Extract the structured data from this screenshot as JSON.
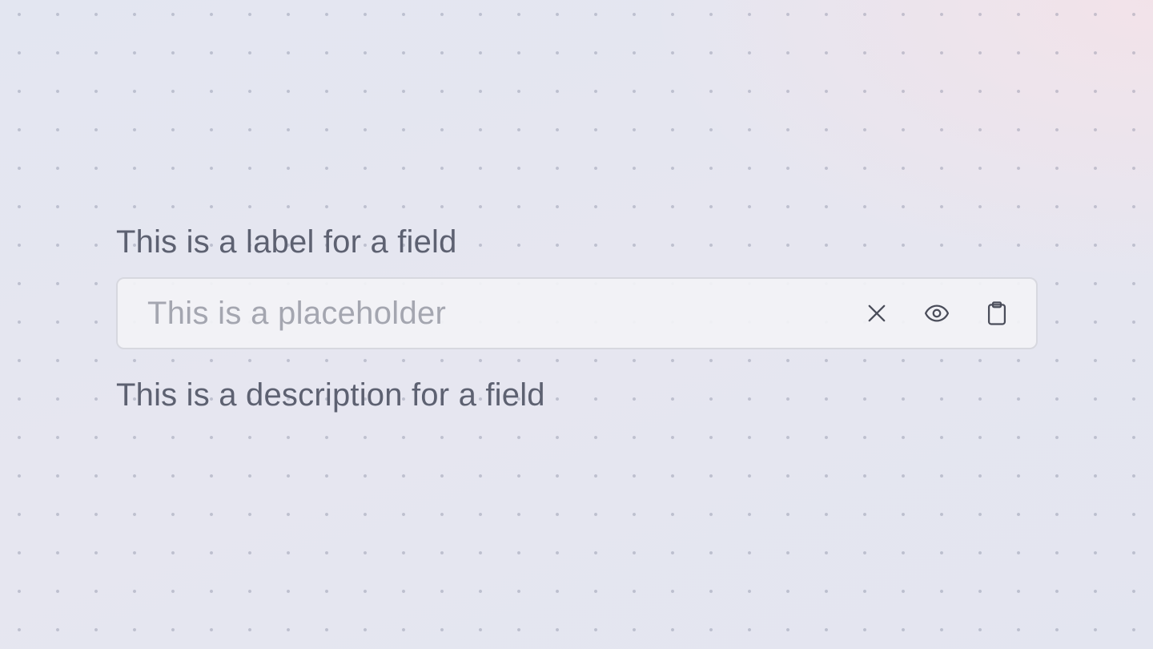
{
  "field": {
    "label": "This is a label for a field",
    "placeholder": "This is a placeholder",
    "value": "",
    "description": "This is a description for a field"
  },
  "actions": [
    {
      "name": "clear",
      "icon": "close-icon"
    },
    {
      "name": "toggle-visibility",
      "icon": "eye-icon"
    },
    {
      "name": "paste",
      "icon": "clipboard-icon"
    }
  ],
  "colors": {
    "text": "#5d6171",
    "placeholder": "#a4a6b0",
    "icon": "#4a4d5a",
    "border": "#d7d8df"
  }
}
